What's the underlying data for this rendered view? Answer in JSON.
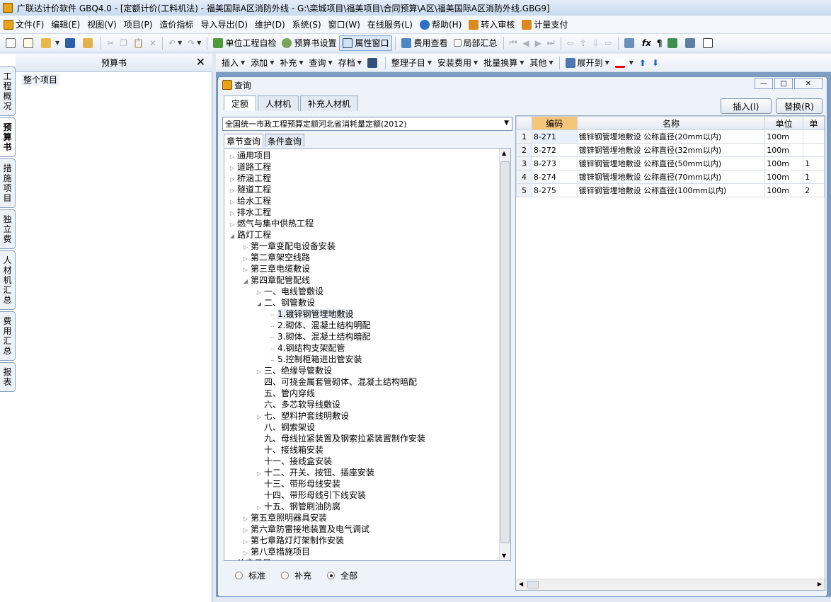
{
  "window": {
    "title": "广联达计价软件 GBQ4.0 - [定额计价(工料机法) - 福美国际A区消防外线 - G:\\栾城项目\\福美项目\\合同预算\\A区\\福美国际A区消防外线.GBG9]"
  },
  "menu": [
    "文件(F)",
    "编辑(E)",
    "视图(V)",
    "项目(P)",
    "造价指标",
    "导入导出(D)",
    "维护(D)",
    "系统(S)",
    "窗口(W)",
    "在线服务(L)",
    "帮助(H)",
    "转入审核",
    "计量支付"
  ],
  "toolbar1": {
    "check": "单位工程自检",
    "budget_settings": "预算书设置",
    "property_window": "属性窗口",
    "fee_view": "费用查看",
    "partial_sum": "局部汇总"
  },
  "toolbar2": [
    "插入",
    "添加",
    "补充",
    "查询",
    "存档",
    "整理子目",
    "安装费用",
    "批量换算",
    "其他",
    "展开到"
  ],
  "left_panel": {
    "header": "预算书",
    "close": "✕",
    "tree_root": "整个项目"
  },
  "side_tabs": [
    "工程概况",
    "预算书",
    "措施项目",
    "独立费",
    "人材机汇总",
    "费用汇总",
    "报表"
  ],
  "dialog": {
    "title": "查询",
    "tabs": [
      "定额",
      "人材机",
      "补充人材机"
    ],
    "insert_btn": "插入(I)",
    "replace_btn": "替换(R)",
    "quota_lib": "全国统一市政工程预算定额河北省消耗量定额(2012)",
    "sub_tabs": [
      "章节查询",
      "条件查询"
    ],
    "tree": [
      {
        "l": 0,
        "t": "通用项目",
        "g": "▷"
      },
      {
        "l": 0,
        "t": "道路工程",
        "g": "▷"
      },
      {
        "l": 0,
        "t": "桥涵工程",
        "g": "▷"
      },
      {
        "l": 0,
        "t": "隧道工程",
        "g": "▷"
      },
      {
        "l": 0,
        "t": "给水工程",
        "g": "▷"
      },
      {
        "l": 0,
        "t": "排水工程",
        "g": "▷"
      },
      {
        "l": 0,
        "t": "燃气与集中供热工程",
        "g": "▷"
      },
      {
        "l": 0,
        "t": "路灯工程",
        "g": "◢"
      },
      {
        "l": 1,
        "t": "第一章变配电设备安装",
        "g": "▷"
      },
      {
        "l": 1,
        "t": "第二章架空线路",
        "g": "▷"
      },
      {
        "l": 1,
        "t": "第三章电缆敷设",
        "g": "▷"
      },
      {
        "l": 1,
        "t": "第四章配管配线",
        "g": "◢"
      },
      {
        "l": 2,
        "t": "一、电线管敷设",
        "g": "▷"
      },
      {
        "l": 2,
        "t": "二、钢管敷设",
        "g": "◢"
      },
      {
        "l": 3,
        "t": "1.镀锌钢管埋地敷设",
        "g": "",
        "sel": true
      },
      {
        "l": 3,
        "t": "2.砌体、混凝土结构明配",
        "g": ""
      },
      {
        "l": 3,
        "t": "3.砌体、混凝土结构暗配",
        "g": ""
      },
      {
        "l": 3,
        "t": "4.钢结构支架配管",
        "g": ""
      },
      {
        "l": 3,
        "t": "5.控制柜箱进出管安装",
        "g": ""
      },
      {
        "l": 2,
        "t": "三、绝缘导管敷设",
        "g": "▷"
      },
      {
        "l": 2,
        "t": "四、可挠金属套管砌体、混凝土结构暗配",
        "g": ""
      },
      {
        "l": 2,
        "t": "五、管内穿线",
        "g": ""
      },
      {
        "l": 2,
        "t": "六、多芯软导线敷设",
        "g": ""
      },
      {
        "l": 2,
        "t": "七、塑料护套线明敷设",
        "g": "▷"
      },
      {
        "l": 2,
        "t": "八、钢索架设",
        "g": ""
      },
      {
        "l": 2,
        "t": "九、母线拉紧装置及钢索拉紧装置制作安装",
        "g": ""
      },
      {
        "l": 2,
        "t": "十、接线箱安装",
        "g": ""
      },
      {
        "l": 2,
        "t": "十一、接线盒安装",
        "g": ""
      },
      {
        "l": 2,
        "t": "十二、开关、按钮、插座安装",
        "g": "▷"
      },
      {
        "l": 2,
        "t": "十三、带形母线安装",
        "g": ""
      },
      {
        "l": 2,
        "t": "十四、带形母线引下线安装",
        "g": ""
      },
      {
        "l": 2,
        "t": "十五、钢管刷油防腐",
        "g": "▷"
      },
      {
        "l": 1,
        "t": "第五章照明器具安装",
        "g": "▷"
      },
      {
        "l": 1,
        "t": "第六章防雷接地装置及电气调试",
        "g": "▷"
      },
      {
        "l": 1,
        "t": "第七章路灯灯架制作安装",
        "g": "▷"
      },
      {
        "l": 1,
        "t": "第八章措施项目",
        "g": "▷"
      },
      {
        "l": 0,
        "t": "补充子目",
        "g": ""
      }
    ],
    "radios": [
      {
        "label": "标准",
        "on": false
      },
      {
        "label": "补充",
        "on": false
      },
      {
        "label": "全部",
        "on": true
      }
    ],
    "grid": {
      "headers": [
        "编码",
        "名称",
        "单位",
        "单"
      ],
      "rows": [
        {
          "n": "1",
          "code": "8-271",
          "name": "镀锌钢管埋地敷设 公称直径(20mm以内)",
          "unit": "100m",
          "p": ""
        },
        {
          "n": "2",
          "code": "8-272",
          "name": "镀锌钢管埋地敷设 公称直径(32mm以内)",
          "unit": "100m",
          "p": ""
        },
        {
          "n": "3",
          "code": "8-273",
          "name": "镀锌钢管埋地敷设 公称直径(50mm以内)",
          "unit": "100m",
          "p": "1"
        },
        {
          "n": "4",
          "code": "8-274",
          "name": "镀锌钢管埋地敷设 公称直径(70mm以内)",
          "unit": "100m",
          "p": "1"
        },
        {
          "n": "5",
          "code": "8-275",
          "name": "镀锌钢管埋地敷设 公称直径(100mm以内)",
          "unit": "100m",
          "p": "2"
        }
      ]
    }
  }
}
